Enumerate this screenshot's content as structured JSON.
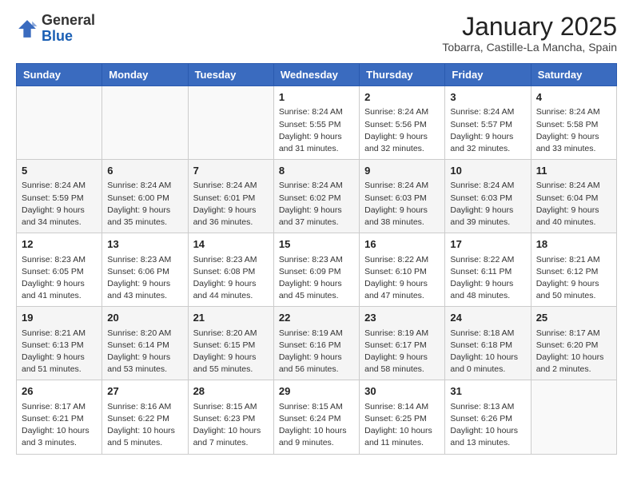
{
  "logo": {
    "general": "General",
    "blue": "Blue"
  },
  "header": {
    "month_title": "January 2025",
    "subtitle": "Tobarra, Castille-La Mancha, Spain"
  },
  "days_of_week": [
    "Sunday",
    "Monday",
    "Tuesday",
    "Wednesday",
    "Thursday",
    "Friday",
    "Saturday"
  ],
  "weeks": [
    [
      {
        "day": "",
        "sunrise": "",
        "sunset": "",
        "daylight": ""
      },
      {
        "day": "",
        "sunrise": "",
        "sunset": "",
        "daylight": ""
      },
      {
        "day": "",
        "sunrise": "",
        "sunset": "",
        "daylight": ""
      },
      {
        "day": "1",
        "sunrise": "Sunrise: 8:24 AM",
        "sunset": "Sunset: 5:55 PM",
        "daylight": "Daylight: 9 hours and 31 minutes."
      },
      {
        "day": "2",
        "sunrise": "Sunrise: 8:24 AM",
        "sunset": "Sunset: 5:56 PM",
        "daylight": "Daylight: 9 hours and 32 minutes."
      },
      {
        "day": "3",
        "sunrise": "Sunrise: 8:24 AM",
        "sunset": "Sunset: 5:57 PM",
        "daylight": "Daylight: 9 hours and 32 minutes."
      },
      {
        "day": "4",
        "sunrise": "Sunrise: 8:24 AM",
        "sunset": "Sunset: 5:58 PM",
        "daylight": "Daylight: 9 hours and 33 minutes."
      }
    ],
    [
      {
        "day": "5",
        "sunrise": "Sunrise: 8:24 AM",
        "sunset": "Sunset: 5:59 PM",
        "daylight": "Daylight: 9 hours and 34 minutes."
      },
      {
        "day": "6",
        "sunrise": "Sunrise: 8:24 AM",
        "sunset": "Sunset: 6:00 PM",
        "daylight": "Daylight: 9 hours and 35 minutes."
      },
      {
        "day": "7",
        "sunrise": "Sunrise: 8:24 AM",
        "sunset": "Sunset: 6:01 PM",
        "daylight": "Daylight: 9 hours and 36 minutes."
      },
      {
        "day": "8",
        "sunrise": "Sunrise: 8:24 AM",
        "sunset": "Sunset: 6:02 PM",
        "daylight": "Daylight: 9 hours and 37 minutes."
      },
      {
        "day": "9",
        "sunrise": "Sunrise: 8:24 AM",
        "sunset": "Sunset: 6:03 PM",
        "daylight": "Daylight: 9 hours and 38 minutes."
      },
      {
        "day": "10",
        "sunrise": "Sunrise: 8:24 AM",
        "sunset": "Sunset: 6:03 PM",
        "daylight": "Daylight: 9 hours and 39 minutes."
      },
      {
        "day": "11",
        "sunrise": "Sunrise: 8:24 AM",
        "sunset": "Sunset: 6:04 PM",
        "daylight": "Daylight: 9 hours and 40 minutes."
      }
    ],
    [
      {
        "day": "12",
        "sunrise": "Sunrise: 8:23 AM",
        "sunset": "Sunset: 6:05 PM",
        "daylight": "Daylight: 9 hours and 41 minutes."
      },
      {
        "day": "13",
        "sunrise": "Sunrise: 8:23 AM",
        "sunset": "Sunset: 6:06 PM",
        "daylight": "Daylight: 9 hours and 43 minutes."
      },
      {
        "day": "14",
        "sunrise": "Sunrise: 8:23 AM",
        "sunset": "Sunset: 6:08 PM",
        "daylight": "Daylight: 9 hours and 44 minutes."
      },
      {
        "day": "15",
        "sunrise": "Sunrise: 8:23 AM",
        "sunset": "Sunset: 6:09 PM",
        "daylight": "Daylight: 9 hours and 45 minutes."
      },
      {
        "day": "16",
        "sunrise": "Sunrise: 8:22 AM",
        "sunset": "Sunset: 6:10 PM",
        "daylight": "Daylight: 9 hours and 47 minutes."
      },
      {
        "day": "17",
        "sunrise": "Sunrise: 8:22 AM",
        "sunset": "Sunset: 6:11 PM",
        "daylight": "Daylight: 9 hours and 48 minutes."
      },
      {
        "day": "18",
        "sunrise": "Sunrise: 8:21 AM",
        "sunset": "Sunset: 6:12 PM",
        "daylight": "Daylight: 9 hours and 50 minutes."
      }
    ],
    [
      {
        "day": "19",
        "sunrise": "Sunrise: 8:21 AM",
        "sunset": "Sunset: 6:13 PM",
        "daylight": "Daylight: 9 hours and 51 minutes."
      },
      {
        "day": "20",
        "sunrise": "Sunrise: 8:20 AM",
        "sunset": "Sunset: 6:14 PM",
        "daylight": "Daylight: 9 hours and 53 minutes."
      },
      {
        "day": "21",
        "sunrise": "Sunrise: 8:20 AM",
        "sunset": "Sunset: 6:15 PM",
        "daylight": "Daylight: 9 hours and 55 minutes."
      },
      {
        "day": "22",
        "sunrise": "Sunrise: 8:19 AM",
        "sunset": "Sunset: 6:16 PM",
        "daylight": "Daylight: 9 hours and 56 minutes."
      },
      {
        "day": "23",
        "sunrise": "Sunrise: 8:19 AM",
        "sunset": "Sunset: 6:17 PM",
        "daylight": "Daylight: 9 hours and 58 minutes."
      },
      {
        "day": "24",
        "sunrise": "Sunrise: 8:18 AM",
        "sunset": "Sunset: 6:18 PM",
        "daylight": "Daylight: 10 hours and 0 minutes."
      },
      {
        "day": "25",
        "sunrise": "Sunrise: 8:17 AM",
        "sunset": "Sunset: 6:20 PM",
        "daylight": "Daylight: 10 hours and 2 minutes."
      }
    ],
    [
      {
        "day": "26",
        "sunrise": "Sunrise: 8:17 AM",
        "sunset": "Sunset: 6:21 PM",
        "daylight": "Daylight: 10 hours and 3 minutes."
      },
      {
        "day": "27",
        "sunrise": "Sunrise: 8:16 AM",
        "sunset": "Sunset: 6:22 PM",
        "daylight": "Daylight: 10 hours and 5 minutes."
      },
      {
        "day": "28",
        "sunrise": "Sunrise: 8:15 AM",
        "sunset": "Sunset: 6:23 PM",
        "daylight": "Daylight: 10 hours and 7 minutes."
      },
      {
        "day": "29",
        "sunrise": "Sunrise: 8:15 AM",
        "sunset": "Sunset: 6:24 PM",
        "daylight": "Daylight: 10 hours and 9 minutes."
      },
      {
        "day": "30",
        "sunrise": "Sunrise: 8:14 AM",
        "sunset": "Sunset: 6:25 PM",
        "daylight": "Daylight: 10 hours and 11 minutes."
      },
      {
        "day": "31",
        "sunrise": "Sunrise: 8:13 AM",
        "sunset": "Sunset: 6:26 PM",
        "daylight": "Daylight: 10 hours and 13 minutes."
      },
      {
        "day": "",
        "sunrise": "",
        "sunset": "",
        "daylight": ""
      }
    ]
  ]
}
